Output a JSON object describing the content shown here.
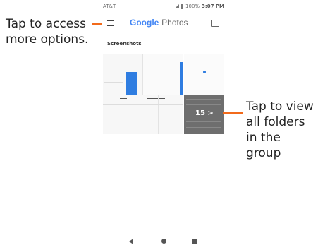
{
  "status_bar": {
    "carrier": "AT&T",
    "battery": "100%",
    "time": "3:07 PM"
  },
  "app_bar": {
    "brand_google": "Google",
    "brand_photos": "Photos",
    "menu_icon": "hamburger-menu-icon",
    "cast_icon": "cast-icon"
  },
  "section": {
    "title": "Screenshots"
  },
  "folder_group": {
    "more_count": "15 >"
  },
  "callouts": {
    "left": "Tap to access more options.",
    "right": "Tap to view all folders in the group"
  },
  "nav_bar": {
    "back_icon": "back-triangle-icon",
    "home_icon": "home-circle-icon",
    "recents_icon": "recents-square-icon"
  },
  "colors": {
    "accent": "#f26a1b",
    "blue": "#2f7de1",
    "overlay": "#6e6e6e"
  }
}
